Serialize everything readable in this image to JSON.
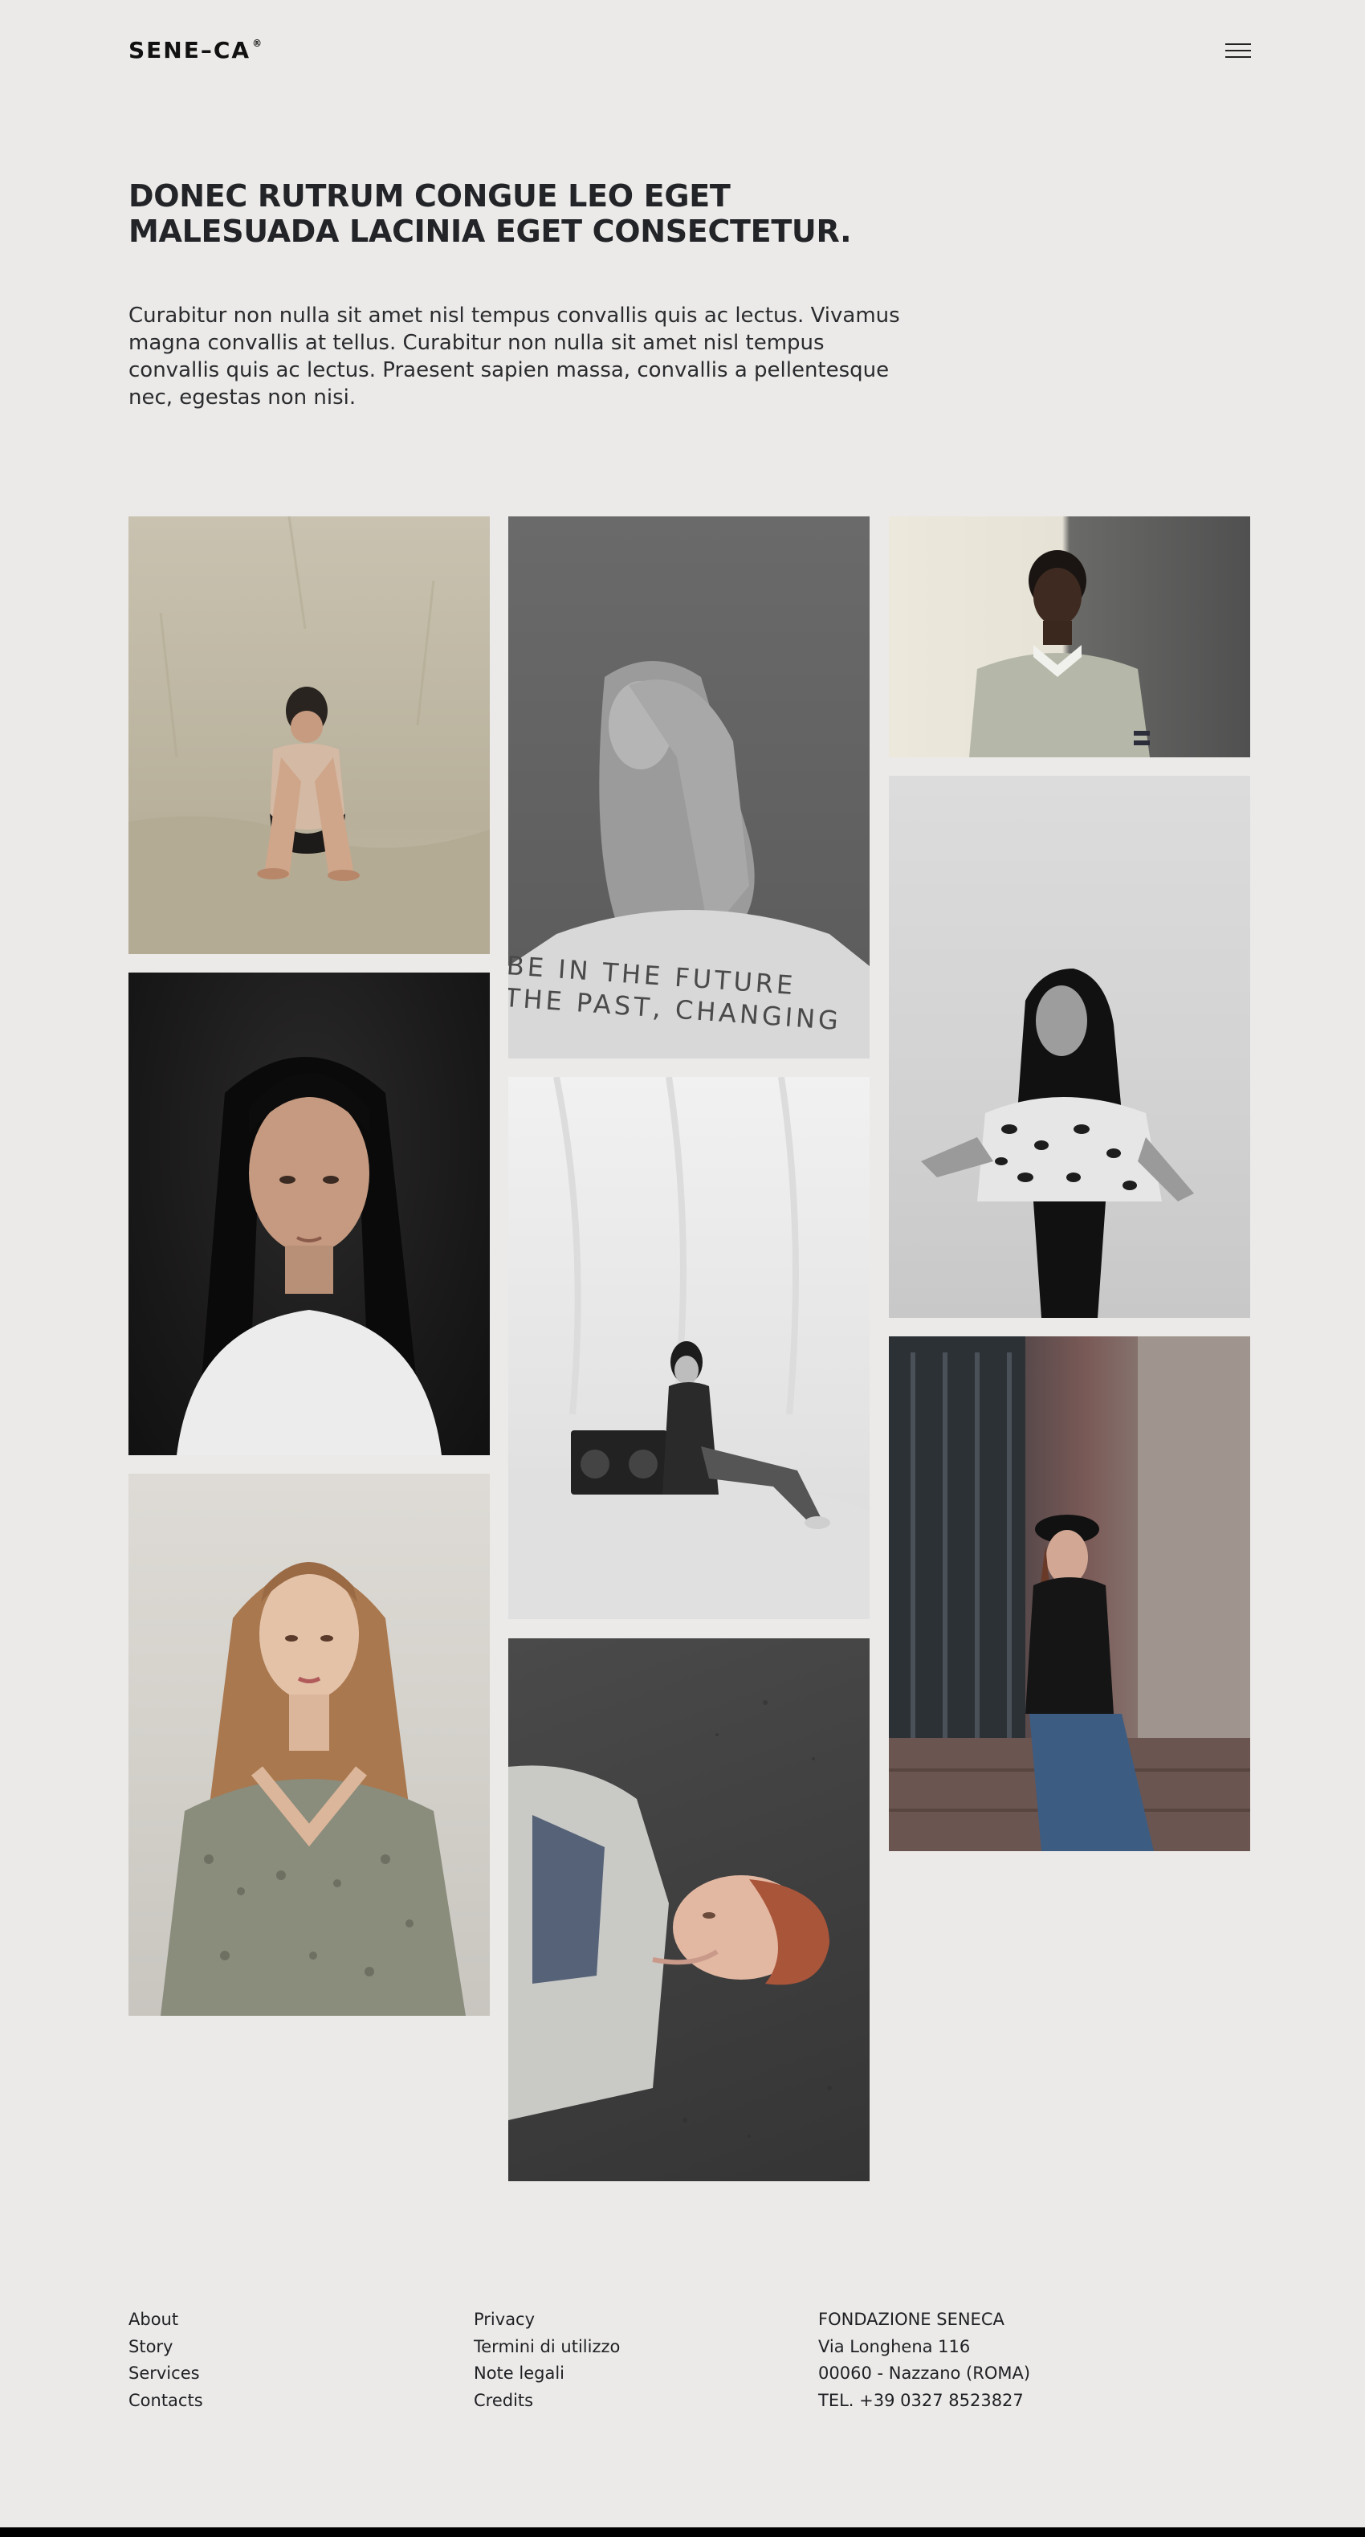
{
  "header": {
    "logo_text": "SENE–CA",
    "logo_mark": "®",
    "menu_icon": "hamburger-icon"
  },
  "hero": {
    "title": "DONEC RUTRUM CONGUE LEO EGET MALESUADA LACINIA EGET CONSECTETUR.",
    "text": "Curabitur non nulla sit amet nisl tempus convallis quis ac lectus. Vivamus magna convallis at tellus. Curabitur non nulla sit amet nisl tempus convallis quis ac lectus. Praesent sapien massa, convallis a pellentesque nec, egestas non nisi."
  },
  "gallery": {
    "photos": [
      {
        "subject": "person-sitting-beige-backdrop"
      },
      {
        "subject": "blonde-woman-grey-backdrop"
      },
      {
        "subject": "man-grey-sweater"
      },
      {
        "subject": "long-hair-man-dark-backdrop"
      },
      {
        "subject": "woman-with-boombox"
      },
      {
        "subject": "woman-floral-dress"
      },
      {
        "subject": "woman-leaning-on-wall"
      },
      {
        "subject": "man-lying-on-asphalt"
      },
      {
        "subject": "woman-on-steps"
      }
    ],
    "banner_text_line1": "BE IN THE FUTURE",
    "banner_text_line2": "THE PAST, CHANGING"
  },
  "footer": {
    "links_col1": [
      "About",
      "Story",
      "Services",
      "Contacts"
    ],
    "links_col2": [
      "Privacy",
      "Termini di utilizzo",
      "Note legali",
      "Credits"
    ],
    "address": [
      "FONDAZIONE SENECA",
      "Via Longhena 116",
      "00060 - Nazzano (ROMA)",
      "TEL. +39 0327 8523827"
    ]
  }
}
